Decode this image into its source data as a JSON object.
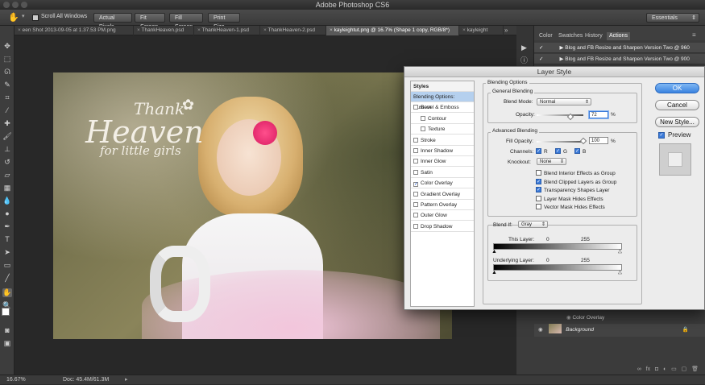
{
  "app": {
    "title": "Adobe Photoshop CS6"
  },
  "options_bar": {
    "scroll_all_windows": "Scroll All Windows",
    "buttons": [
      "Actual Pixels",
      "Fit Screen",
      "Fill Screen",
      "Print Size"
    ],
    "workspace": "Essentials"
  },
  "tabs": [
    {
      "label": "een Shot 2013-09-05 at 1.37.53 PM.png"
    },
    {
      "label": "ThankHeaven.psd"
    },
    {
      "label": "ThankHeaven-1.psd"
    },
    {
      "label": "ThankHeaven-2.psd"
    },
    {
      "label": "kayleightut.png @ 16.7% (Shape 1 copy, RGB/8*)"
    },
    {
      "label": "kayleight"
    }
  ],
  "photo_text": {
    "line1": "Thank",
    "line2": "Heaven",
    "line3": "for little girls"
  },
  "status": {
    "zoom": "16.67%",
    "doc": "Doc: 45.4M/61.3M"
  },
  "panels": {
    "tabs": [
      "Color",
      "Swatches",
      "History",
      "Actions"
    ],
    "actions": [
      "Blog and FB Resize and Sharpen Version Two @ 960",
      "Blog and FB Resize and Sharpen Version Two @ 900"
    ],
    "layers": {
      "effect": "Color Overlay",
      "background": "Background"
    }
  },
  "dialog": {
    "title": "Layer Style",
    "styles_header": "Styles",
    "styles": [
      {
        "label": "Blending Options: Custom",
        "checkbox": false,
        "checked": false
      },
      {
        "label": "Bevel & Emboss",
        "checkbox": true,
        "checked": false
      },
      {
        "label": "Contour",
        "checkbox": true,
        "checked": false
      },
      {
        "label": "Texture",
        "checkbox": true,
        "checked": false
      },
      {
        "label": "Stroke",
        "checkbox": true,
        "checked": false
      },
      {
        "label": "Inner Shadow",
        "checkbox": true,
        "checked": false
      },
      {
        "label": "Inner Glow",
        "checkbox": true,
        "checked": false
      },
      {
        "label": "Satin",
        "checkbox": true,
        "checked": false
      },
      {
        "label": "Color Overlay",
        "checkbox": true,
        "checked": true
      },
      {
        "label": "Gradient Overlay",
        "checkbox": true,
        "checked": false
      },
      {
        "label": "Pattern Overlay",
        "checkbox": true,
        "checked": false
      },
      {
        "label": "Outer Glow",
        "checkbox": true,
        "checked": false
      },
      {
        "label": "Drop Shadow",
        "checkbox": true,
        "checked": false
      }
    ],
    "blending_options": "Blending Options",
    "general_blending": "General Blending",
    "blend_mode_label": "Blend Mode:",
    "blend_mode": "Normal",
    "opacity_label": "Opacity:",
    "opacity": "72",
    "percent": "%",
    "advanced_blending": "Advanced Blending",
    "fill_opacity_label": "Fill Opacity:",
    "fill_opacity": "100",
    "channels_label": "Channels:",
    "channels": [
      "R",
      "G",
      "B"
    ],
    "knockout_label": "Knockout:",
    "knockout": "None",
    "options": [
      {
        "label": "Blend Interior Effects as Group",
        "checked": false
      },
      {
        "label": "Blend Clipped Layers as Group",
        "checked": true
      },
      {
        "label": "Transparency Shapes Layer",
        "checked": true
      },
      {
        "label": "Layer Mask Hides Effects",
        "checked": false
      },
      {
        "label": "Vector Mask Hides Effects",
        "checked": false
      }
    ],
    "blend_if_label": "Blend If:",
    "blend_if": "Gray",
    "this_layer": "This Layer:",
    "underlying_layer": "Underlying Layer:",
    "range_min": "0",
    "range_max": "255",
    "buttons": {
      "ok": "OK",
      "cancel": "Cancel",
      "new_style": "New Style...",
      "preview": "Preview"
    }
  }
}
